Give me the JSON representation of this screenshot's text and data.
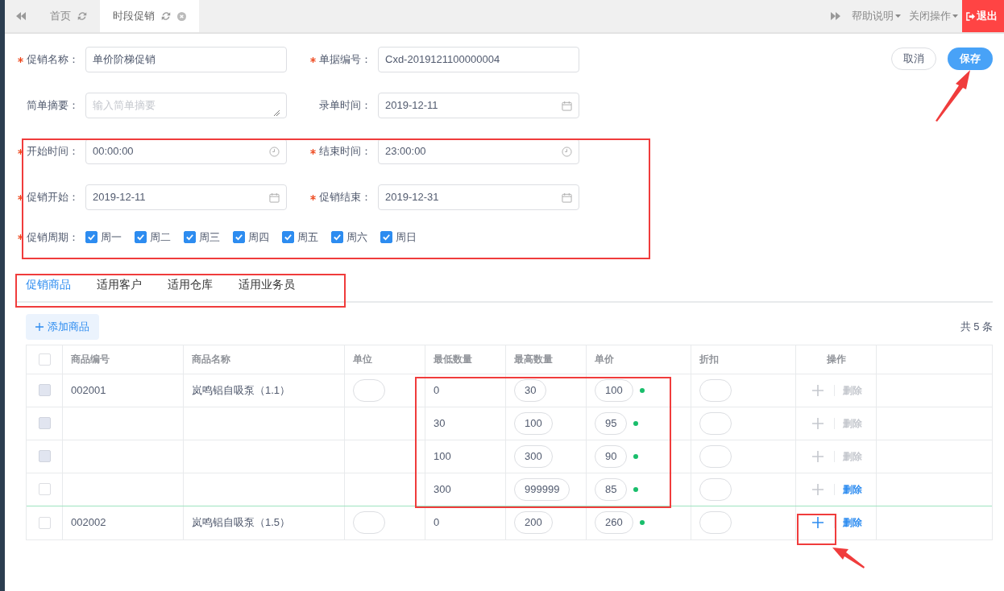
{
  "top_tabs": [
    {
      "label": "首页",
      "selected": false,
      "closable": false
    },
    {
      "label": "时段促销",
      "selected": true,
      "closable": true
    }
  ],
  "top_menus": [
    {
      "label": "帮助说明"
    },
    {
      "label": "关闭操作"
    }
  ],
  "logout": "退出",
  "form_rows": [
    [
      {
        "label": "促销名称：",
        "required": true,
        "value": "单价阶梯促销",
        "kind": "text"
      },
      {
        "label": "单据编号：",
        "required": true,
        "value": "Cxd-2019121100000004",
        "kind": "text"
      }
    ],
    [
      {
        "label": "简单摘要：",
        "required": false,
        "placeholder": "输入简单摘要",
        "kind": "textarea"
      },
      {
        "label": "录单时间：",
        "required": false,
        "value": "2019-12-11",
        "kind": "date"
      }
    ],
    [
      {
        "label": "开始时间：",
        "required": true,
        "value": "00:00:00",
        "kind": "time"
      },
      {
        "label": "结束时间：",
        "required": true,
        "value": "23:00:00",
        "kind": "time"
      }
    ],
    [
      {
        "label": "促销开始：",
        "required": true,
        "value": "2019-12-11",
        "kind": "date"
      },
      {
        "label": "促销结束：",
        "required": true,
        "value": "2019-12-31",
        "kind": "date"
      }
    ]
  ],
  "weekdays": {
    "label": "促销周期：",
    "required": true,
    "days": [
      {
        "label": "周一",
        "checked": true
      },
      {
        "label": "周二",
        "checked": true
      },
      {
        "label": "周三",
        "checked": true
      },
      {
        "label": "周四",
        "checked": true
      },
      {
        "label": "周五",
        "checked": true
      },
      {
        "label": "周六",
        "checked": true
      },
      {
        "label": "周日",
        "checked": true
      }
    ]
  },
  "buttons": {
    "cancel": "取消",
    "save": "保存"
  },
  "sub_tabs": [
    {
      "label": "促销商品",
      "selected": true
    },
    {
      "label": "适用客户",
      "selected": false
    },
    {
      "label": "适用仓库",
      "selected": false
    },
    {
      "label": "适用业务员",
      "selected": false
    }
  ],
  "add_button": "添加商品",
  "count": "共 5 条",
  "table": {
    "header_checked": false,
    "columns": [
      "商品编号",
      "商品名称",
      "单位",
      "最低数量",
      "最高数量",
      "单价",
      "折扣",
      "操作"
    ],
    "rows": [
      {
        "checked": false,
        "disabled": true,
        "code": "002001",
        "name": "岚鸣铝自吸泵（1.1）",
        "unit_input": true,
        "min": "0",
        "max": "30",
        "price": "100",
        "add_disabled": true,
        "delete": "删除",
        "delete_disabled": true
      },
      {
        "checked": false,
        "disabled": true,
        "unit_input": false,
        "min": "30",
        "max": "100",
        "price": "95",
        "add_disabled": true,
        "delete": "删除",
        "delete_disabled": true
      },
      {
        "checked": false,
        "disabled": true,
        "unit_input": false,
        "min": "100",
        "max": "300",
        "price": "90",
        "add_disabled": true,
        "delete": "删除",
        "delete_disabled": true
      },
      {
        "checked": false,
        "disabled": false,
        "unit_input": false,
        "min": "300",
        "max": "999999",
        "price": "85",
        "add_disabled": true,
        "delete": "删除",
        "delete_disabled": false
      },
      {
        "checked": false,
        "disabled": false,
        "code": "002002",
        "name": "岚鸣铝自吸泵（1.5）",
        "unit_input": true,
        "min": "0",
        "max": "200",
        "price": "260",
        "add_disabled": false,
        "delete": "删除",
        "delete_disabled": false
      }
    ]
  }
}
